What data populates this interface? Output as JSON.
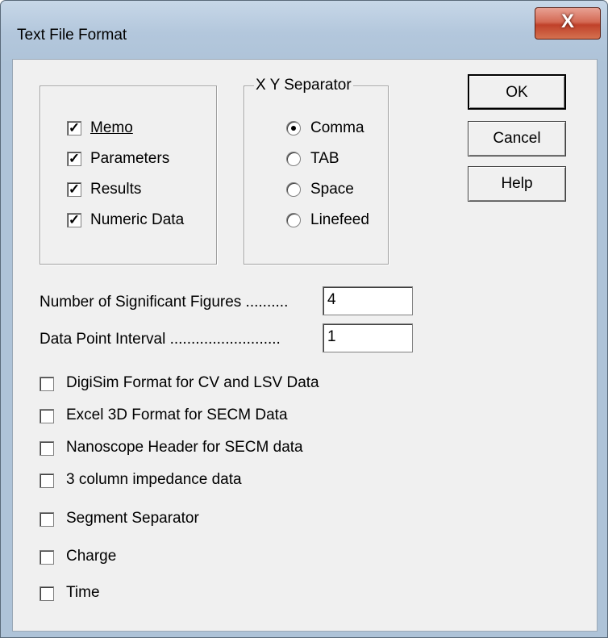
{
  "window": {
    "title": "Text File Format",
    "close_label": "X"
  },
  "content_group": {
    "items": [
      {
        "label": "Memo",
        "checked": true
      },
      {
        "label": "Parameters",
        "checked": true
      },
      {
        "label": "Results",
        "checked": true
      },
      {
        "label": "Numeric Data",
        "checked": true
      }
    ]
  },
  "xy_separator": {
    "legend": "X Y Separator",
    "selected": "Comma",
    "options": [
      {
        "label": "Comma",
        "selected": true
      },
      {
        "label": "TAB",
        "selected": false
      },
      {
        "label": "Space",
        "selected": false
      },
      {
        "label": "Linefeed",
        "selected": false
      }
    ]
  },
  "buttons": {
    "ok": "OK",
    "cancel": "Cancel",
    "help": "Help"
  },
  "fields": {
    "sig_figs": {
      "label": "Number of Significant Figures ..........",
      "value": "4"
    },
    "interval": {
      "label": "Data Point Interval ..........................",
      "value": "1"
    }
  },
  "options": [
    {
      "label": "DigiSim Format for CV and LSV Data",
      "checked": false
    },
    {
      "label": "Excel 3D Format for SECM Data",
      "checked": false
    },
    {
      "label": "Nanoscope Header for SECM data",
      "checked": false
    },
    {
      "label": "3 column impedance data",
      "checked": false
    },
    {
      "label": "Segment Separator",
      "checked": false
    },
    {
      "label": "Charge",
      "checked": false
    },
    {
      "label": "Time",
      "checked": false
    }
  ]
}
